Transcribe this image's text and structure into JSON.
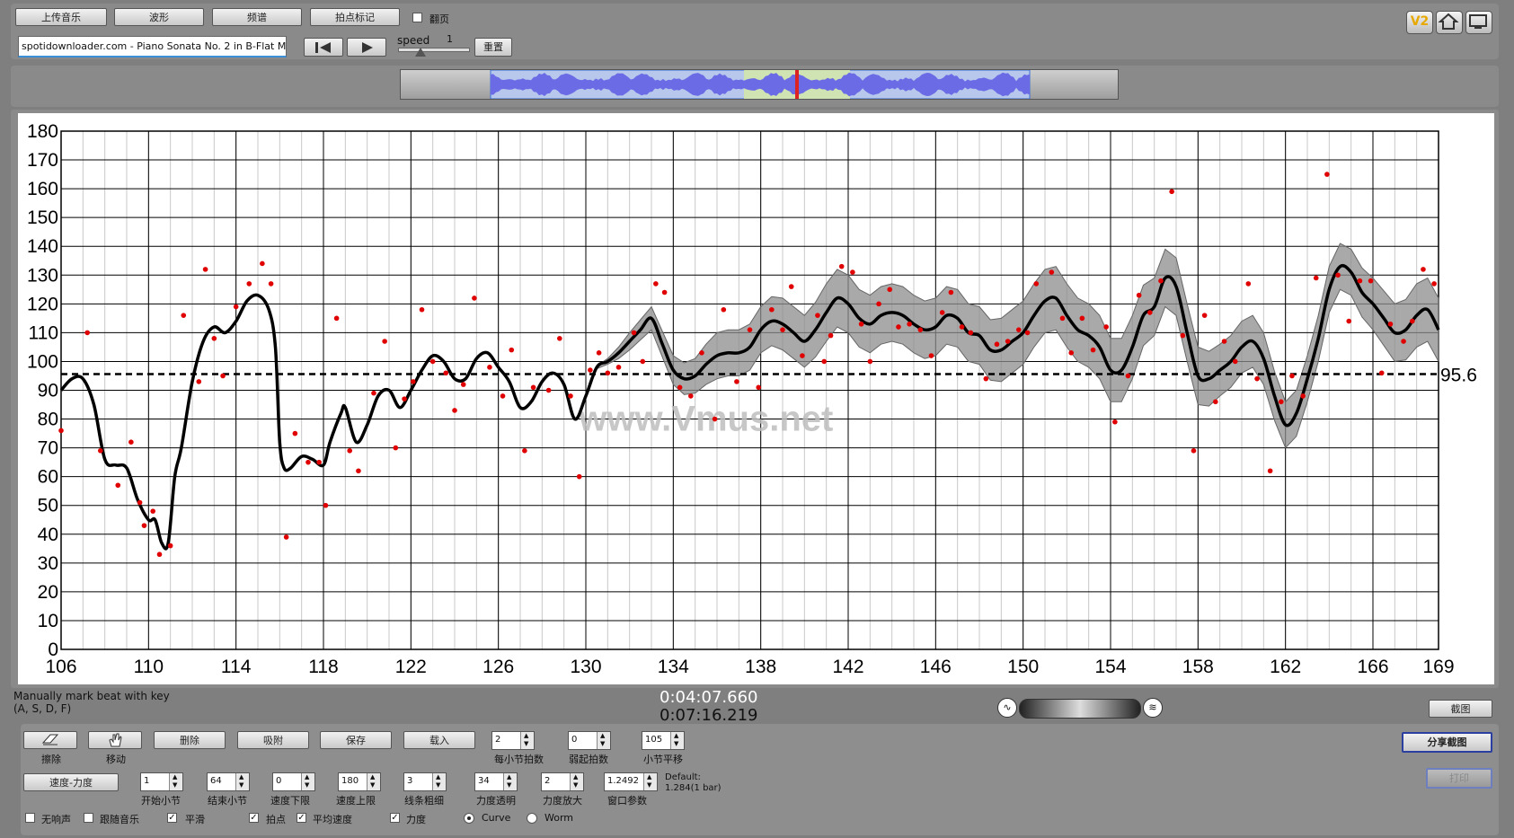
{
  "toolbar": {
    "upload_label": "上传音乐",
    "waveform_label": "波形",
    "spectrum_label": "频谱",
    "beat_label": "拍点标记",
    "flip_label": "翻页",
    "speed_label": "speed",
    "speed_value": "1",
    "reset_label": "重置",
    "file_name": "spotidownloader.com - Piano Sonata No. 2 in B-Flat Minor, Op. 35",
    "logo_text": "V2"
  },
  "status": {
    "hint_line1": "Manually mark beat with key",
    "hint_line2": "(A, S, D, F)",
    "current_time": "0:04:07.660",
    "total_time": "0:07:16.219",
    "screenshot_label": "截图"
  },
  "tools": [
    {
      "label": "擦除",
      "icon": "eraser-icon"
    },
    {
      "label": "移动",
      "icon": "hand-icon"
    }
  ],
  "actions": {
    "delete": "删除",
    "snap": "吸附",
    "save": "保存",
    "load": "载入",
    "tempo_dynamics": "速度-力度",
    "share": "分享截图",
    "print": "打印"
  },
  "params_row1": [
    {
      "label": "每小节拍数",
      "value": "2"
    },
    {
      "label": "弱起拍数",
      "value": "0"
    },
    {
      "label": "小节平移",
      "value": "105"
    }
  ],
  "params_row2": [
    {
      "label": "开始小节",
      "value": "1"
    },
    {
      "label": "结束小节",
      "value": "64"
    },
    {
      "label": "速度下限",
      "value": "0"
    },
    {
      "label": "速度上限",
      "value": "180"
    },
    {
      "label": "线条粗细",
      "value": "3"
    },
    {
      "label": "力度透明",
      "value": "34"
    },
    {
      "label": "力度放大",
      "value": "2"
    },
    {
      "label": "窗口参数",
      "value": "1.2492"
    }
  ],
  "default_note": {
    "line1": "Default:",
    "line2": "1.284(1 bar)"
  },
  "options": [
    {
      "label": "无响声",
      "checked": false
    },
    {
      "label": "跟随音乐",
      "checked": false
    },
    {
      "label": "平滑",
      "checked": true
    },
    {
      "label": "拍点",
      "checked": true
    },
    {
      "label": "平均速度",
      "checked": true
    },
    {
      "label": "力度",
      "checked": true
    }
  ],
  "modes": [
    {
      "label": "Curve",
      "selected": true
    },
    {
      "label": "Worm",
      "selected": false
    }
  ],
  "colors": {
    "points": "#e00000",
    "band": "#8c8c8c",
    "line": "#000000"
  },
  "chart_data": {
    "type": "line",
    "title": "",
    "xlabel": "",
    "ylabel": "",
    "xlim": [
      106,
      169
    ],
    "ylim": [
      0,
      180
    ],
    "x_ticks": [
      106,
      110,
      114,
      118,
      122,
      126,
      130,
      134,
      138,
      142,
      146,
      150,
      154,
      158,
      162,
      166,
      169
    ],
    "y_ticks": [
      0,
      10,
      20,
      30,
      40,
      50,
      60,
      70,
      80,
      90,
      100,
      110,
      120,
      130,
      140,
      150,
      160,
      170,
      180
    ],
    "average_tempo": 95.6,
    "average_label": "95.6",
    "watermark": "www.Vmus.net",
    "curve": [
      [
        106,
        90
      ],
      [
        106.5,
        94
      ],
      [
        107,
        94
      ],
      [
        107.5,
        85
      ],
      [
        108,
        66
      ],
      [
        108.5,
        64
      ],
      [
        109,
        63
      ],
      [
        109.5,
        52
      ],
      [
        110,
        45
      ],
      [
        110.3,
        45
      ],
      [
        110.6,
        37
      ],
      [
        110.9,
        37
      ],
      [
        111.2,
        60
      ],
      [
        111.5,
        70
      ],
      [
        112,
        93
      ],
      [
        112.5,
        107
      ],
      [
        113,
        112
      ],
      [
        113.5,
        110
      ],
      [
        114,
        114
      ],
      [
        114.5,
        121
      ],
      [
        115,
        123
      ],
      [
        115.5,
        118
      ],
      [
        115.8,
        105
      ],
      [
        116,
        72
      ],
      [
        116.2,
        63
      ],
      [
        116.5,
        63
      ],
      [
        117,
        67
      ],
      [
        117.5,
        66
      ],
      [
        118,
        64
      ],
      [
        118.3,
        72
      ],
      [
        118.8,
        82
      ],
      [
        119,
        84
      ],
      [
        119.5,
        72
      ],
      [
        120,
        78
      ],
      [
        120.5,
        88
      ],
      [
        121,
        90
      ],
      [
        121.5,
        84
      ],
      [
        122,
        90
      ],
      [
        122.5,
        97
      ],
      [
        123,
        102
      ],
      [
        123.5,
        100
      ],
      [
        124,
        94
      ],
      [
        124.5,
        94
      ],
      [
        125,
        101
      ],
      [
        125.5,
        103
      ],
      [
        126,
        98
      ],
      [
        126.5,
        93
      ],
      [
        127,
        84
      ],
      [
        127.5,
        86
      ],
      [
        128,
        93
      ],
      [
        128.5,
        96
      ],
      [
        129,
        92
      ],
      [
        129.5,
        80
      ],
      [
        130,
        88
      ],
      [
        130.5,
        98
      ],
      [
        131,
        100
      ],
      [
        131.5,
        103
      ],
      [
        132,
        107
      ],
      [
        132.5,
        111
      ],
      [
        133,
        115
      ],
      [
        133.5,
        106
      ],
      [
        134,
        97
      ],
      [
        134.5,
        94
      ],
      [
        135,
        95
      ],
      [
        135.5,
        99
      ],
      [
        136,
        102
      ],
      [
        136.5,
        103
      ],
      [
        137,
        103
      ],
      [
        137.5,
        105
      ],
      [
        138,
        111
      ],
      [
        138.5,
        114
      ],
      [
        139,
        113
      ],
      [
        139.5,
        110
      ],
      [
        140,
        107
      ],
      [
        140.5,
        111
      ],
      [
        141,
        117
      ],
      [
        141.5,
        122
      ],
      [
        142,
        120
      ],
      [
        142.5,
        115
      ],
      [
        143,
        113
      ],
      [
        143.5,
        116
      ],
      [
        144,
        117
      ],
      [
        144.5,
        116
      ],
      [
        145,
        113
      ],
      [
        145.5,
        111
      ],
      [
        146,
        112
      ],
      [
        146.5,
        116
      ],
      [
        147,
        115
      ],
      [
        147.5,
        110
      ],
      [
        148,
        109
      ],
      [
        148.5,
        104
      ],
      [
        149,
        104
      ],
      [
        149.5,
        107
      ],
      [
        150,
        110
      ],
      [
        150.5,
        116
      ],
      [
        151,
        121
      ],
      [
        151.5,
        122
      ],
      [
        152,
        116
      ],
      [
        152.5,
        111
      ],
      [
        153,
        109
      ],
      [
        153.5,
        105
      ],
      [
        154,
        97
      ],
      [
        154.5,
        97
      ],
      [
        155,
        105
      ],
      [
        155.5,
        116
      ],
      [
        156,
        119
      ],
      [
        156.5,
        129
      ],
      [
        157,
        126
      ],
      [
        157.5,
        110
      ],
      [
        158,
        95
      ],
      [
        158.5,
        94
      ],
      [
        159,
        97
      ],
      [
        159.5,
        100
      ],
      [
        160,
        105
      ],
      [
        160.5,
        107
      ],
      [
        161,
        101
      ],
      [
        161.5,
        88
      ],
      [
        162,
        78
      ],
      [
        162.5,
        82
      ],
      [
        163,
        94
      ],
      [
        163.5,
        108
      ],
      [
        164,
        125
      ],
      [
        164.5,
        133
      ],
      [
        165,
        131
      ],
      [
        165.5,
        124
      ],
      [
        166,
        120
      ],
      [
        166.5,
        115
      ],
      [
        167,
        110
      ],
      [
        167.5,
        111
      ],
      [
        168,
        116
      ],
      [
        168.5,
        118
      ],
      [
        169,
        111
      ]
    ],
    "band_start": 130,
    "band_width": [
      0,
      1,
      3,
      4,
      5,
      6,
      8,
      8,
      8,
      9,
      9,
      10,
      10,
      10,
      10,
      10,
      10,
      10,
      10,
      11,
      11,
      11,
      11,
      11,
      11,
      11,
      10,
      10,
      10,
      9,
      9,
      9,
      8,
      8,
      8,
      8,
      9,
      10,
      11,
      11
    ],
    "points": [
      [
        106,
        76
      ],
      [
        107.2,
        110
      ],
      [
        108.6,
        57
      ],
      [
        107.8,
        69
      ],
      [
        109.2,
        72
      ],
      [
        109.6,
        51
      ],
      [
        110.2,
        48
      ],
      [
        109.8,
        43
      ],
      [
        110.5,
        33
      ],
      [
        111,
        36
      ],
      [
        111.6,
        116
      ],
      [
        112.3,
        93
      ],
      [
        112.6,
        132
      ],
      [
        113,
        108
      ],
      [
        113.4,
        95
      ],
      [
        114,
        119
      ],
      [
        114.6,
        127
      ],
      [
        115.2,
        134
      ],
      [
        115.6,
        127
      ],
      [
        116.3,
        39
      ],
      [
        116.7,
        75
      ],
      [
        117.3,
        65
      ],
      [
        117.8,
        65
      ],
      [
        118.1,
        50
      ],
      [
        118.6,
        115
      ],
      [
        119.2,
        69
      ],
      [
        119.6,
        62
      ],
      [
        120.3,
        89
      ],
      [
        120.8,
        107
      ],
      [
        121.3,
        70
      ],
      [
        121.7,
        87
      ],
      [
        122.1,
        93
      ],
      [
        122.5,
        118
      ],
      [
        123,
        100
      ],
      [
        123.6,
        96
      ],
      [
        124,
        83
      ],
      [
        124.4,
        92
      ],
      [
        124.9,
        122
      ],
      [
        125.6,
        98
      ],
      [
        126.2,
        88
      ],
      [
        126.6,
        104
      ],
      [
        127.2,
        69
      ],
      [
        127.6,
        91
      ],
      [
        128.3,
        90
      ],
      [
        128.8,
        108
      ],
      [
        129.3,
        88
      ],
      [
        129.7,
        60
      ],
      [
        130.2,
        97
      ],
      [
        130.6,
        103
      ],
      [
        131,
        96
      ],
      [
        131.5,
        98
      ],
      [
        132.2,
        110
      ],
      [
        132.6,
        100
      ],
      [
        133.2,
        127
      ],
      [
        133.6,
        124
      ],
      [
        134.3,
        91
      ],
      [
        134.8,
        88
      ],
      [
        135.3,
        103
      ],
      [
        135.9,
        80
      ],
      [
        136.3,
        118
      ],
      [
        136.9,
        93
      ],
      [
        137.5,
        111
      ],
      [
        137.9,
        91
      ],
      [
        138.5,
        118
      ],
      [
        139,
        111
      ],
      [
        139.4,
        126
      ],
      [
        139.9,
        102
      ],
      [
        140.6,
        116
      ],
      [
        140.9,
        100
      ],
      [
        141.2,
        109
      ],
      [
        141.7,
        133
      ],
      [
        142.2,
        131
      ],
      [
        142.6,
        113
      ],
      [
        143,
        100
      ],
      [
        143.4,
        120
      ],
      [
        143.9,
        125
      ],
      [
        144.3,
        112
      ],
      [
        144.8,
        113
      ],
      [
        145.3,
        111
      ],
      [
        145.8,
        102
      ],
      [
        146.3,
        117
      ],
      [
        146.7,
        124
      ],
      [
        147.2,
        112
      ],
      [
        147.6,
        110
      ],
      [
        148.3,
        94
      ],
      [
        148.8,
        106
      ],
      [
        149.3,
        107
      ],
      [
        149.8,
        111
      ],
      [
        150.2,
        110
      ],
      [
        150.6,
        127
      ],
      [
        151.3,
        131
      ],
      [
        151.8,
        115
      ],
      [
        152.2,
        103
      ],
      [
        152.7,
        115
      ],
      [
        153.2,
        104
      ],
      [
        153.8,
        112
      ],
      [
        154.2,
        79
      ],
      [
        154.8,
        95
      ],
      [
        155.3,
        123
      ],
      [
        155.8,
        117
      ],
      [
        156.3,
        128
      ],
      [
        156.8,
        159
      ],
      [
        157.3,
        109
      ],
      [
        157.8,
        69
      ],
      [
        158.3,
        116
      ],
      [
        158.8,
        86
      ],
      [
        159.2,
        107
      ],
      [
        159.7,
        100
      ],
      [
        160.3,
        127
      ],
      [
        160.7,
        94
      ],
      [
        161.3,
        62
      ],
      [
        161.8,
        86
      ],
      [
        162.3,
        95
      ],
      [
        162.8,
        88
      ],
      [
        163.4,
        129
      ],
      [
        163.9,
        165
      ],
      [
        164.4,
        130
      ],
      [
        164.9,
        114
      ],
      [
        165.4,
        128
      ],
      [
        165.9,
        128
      ],
      [
        166.4,
        96
      ],
      [
        166.8,
        113
      ],
      [
        167.4,
        107
      ],
      [
        167.8,
        114
      ],
      [
        168.3,
        132
      ],
      [
        168.8,
        127
      ]
    ]
  }
}
